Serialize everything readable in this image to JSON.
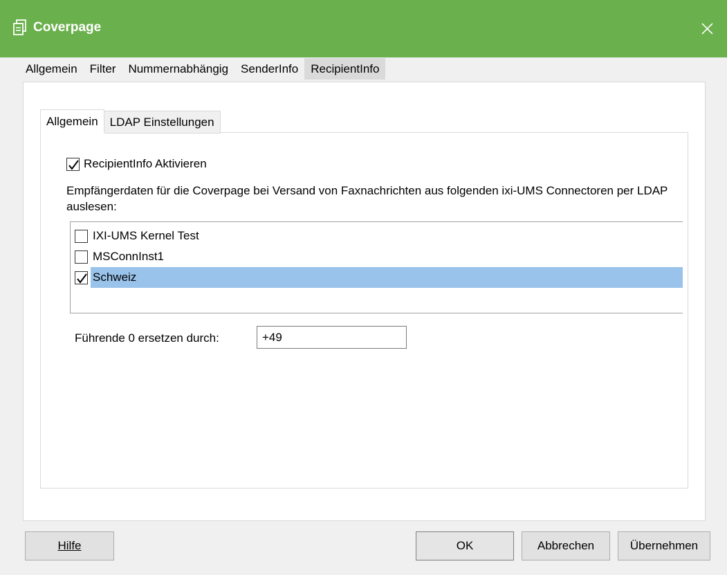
{
  "window": {
    "title": "Coverpage"
  },
  "outer_tabs": [
    {
      "label": "Allgemein"
    },
    {
      "label": "Filter"
    },
    {
      "label": "Nummernabhängig"
    },
    {
      "label": "SenderInfo"
    },
    {
      "label": "RecipientInfo",
      "active": true
    }
  ],
  "inner_tabs": [
    {
      "label": "Allgemein",
      "active": true
    },
    {
      "label": "LDAP Einstellungen"
    }
  ],
  "recipientinfo": {
    "activate_label": "RecipientInfo Aktivieren",
    "activate_checked": true,
    "description": "Empfängerdaten für die Coverpage bei Versand von Faxnachrichten aus folgenden ixi-UMS Connectoren per LDAP auslesen:",
    "connectors": [
      {
        "label": "IXI-UMS Kernel Test",
        "checked": false,
        "selected": false
      },
      {
        "label": "MSConnInst1",
        "checked": false,
        "selected": false
      },
      {
        "label": "Schweiz",
        "checked": true,
        "selected": true
      }
    ],
    "leading_zero_label": "Führende 0 ersetzen durch:",
    "leading_zero_value": "+49"
  },
  "buttons": {
    "help": "Hilfe",
    "ok": "OK",
    "cancel": "Abbrechen",
    "apply": "Übernehmen"
  },
  "colors": {
    "titlebar": "#6ab04c",
    "selection": "#99c3ea"
  }
}
